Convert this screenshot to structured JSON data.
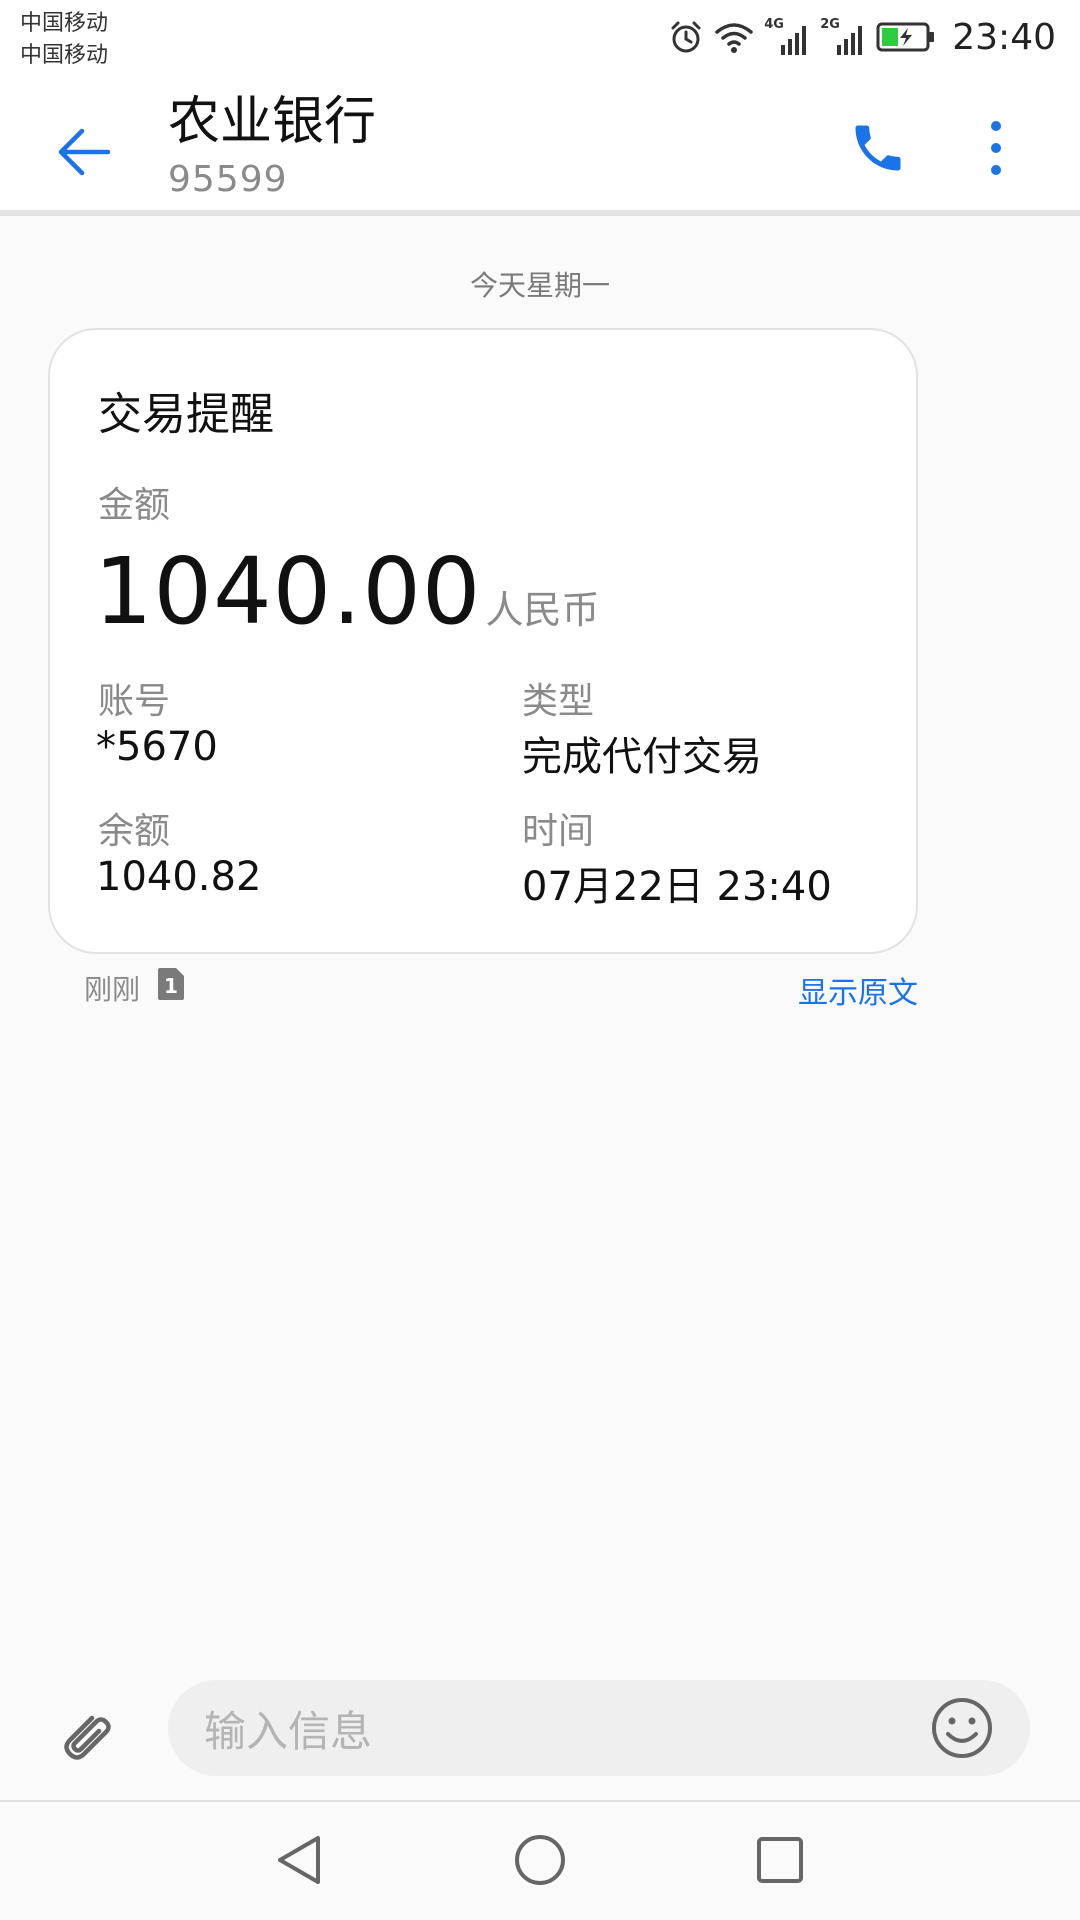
{
  "status_bar": {
    "carrier_1": "中国移动",
    "carrier_2": "中国移动",
    "network_1": "4G",
    "network_2": "2G",
    "time": "23:40",
    "icons": [
      "alarm-icon",
      "wifi-icon",
      "signal-icon",
      "signal-icon",
      "battery-charging-icon"
    ]
  },
  "app_bar": {
    "contact_name": "农业银行",
    "contact_number": "95599",
    "icons": [
      "back-arrow-icon",
      "phone-icon",
      "more-vert-icon"
    ]
  },
  "conversation": {
    "date_label": "今天星期一",
    "card": {
      "title": "交易提醒",
      "amount_label": "金额",
      "amount_value": "1040.00",
      "amount_currency": "人民币",
      "account_label": "账号",
      "account_value": "*5670",
      "type_label": "类型",
      "type_value": "完成代付交易",
      "balance_label": "余额",
      "balance_value": "1040.82",
      "time_label": "时间",
      "time_value": "07月22日 23:40"
    },
    "message_time": "刚刚",
    "sim_slot": "1",
    "show_original": "显示原文"
  },
  "input_bar": {
    "placeholder": "输入信息",
    "icons": [
      "attach-icon",
      "emoji-icon"
    ]
  },
  "nav_bar": {
    "icons": [
      "nav-back-icon",
      "nav-home-icon",
      "nav-recents-icon"
    ]
  },
  "colors": {
    "accent": "#1a73e8",
    "text_primary": "#111111",
    "text_secondary": "#8a8a8a",
    "battery_fill": "#2ecc40"
  }
}
